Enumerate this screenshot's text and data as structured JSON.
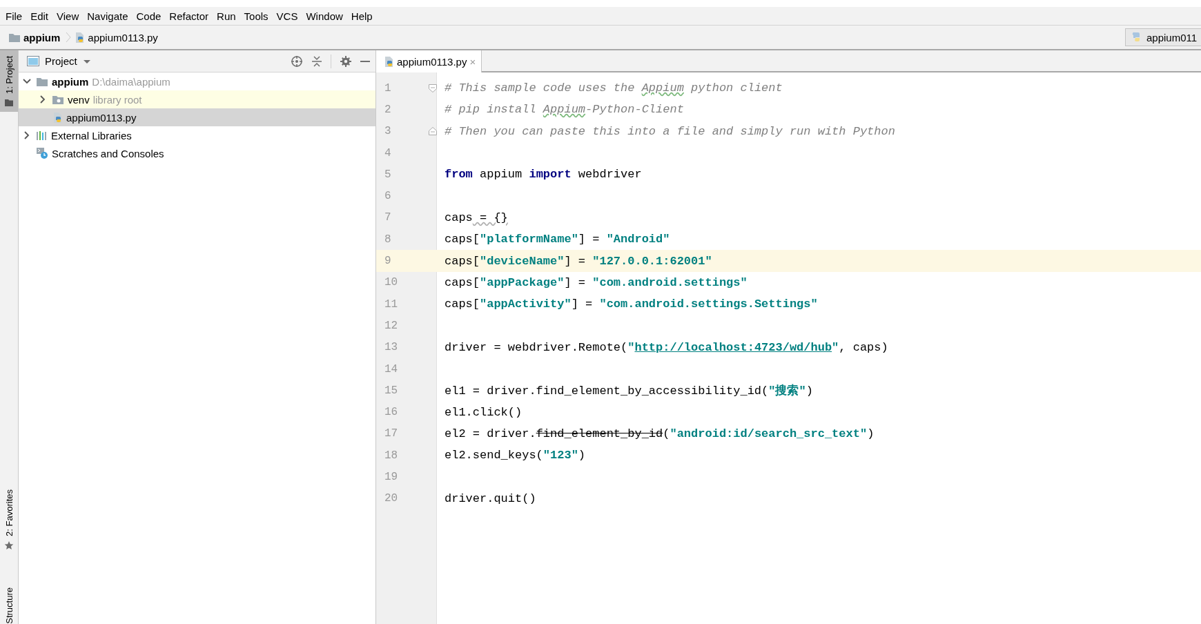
{
  "menu_bar": [
    "File",
    "Edit",
    "View",
    "Navigate",
    "Code",
    "Refactor",
    "Run",
    "Tools",
    "VCS",
    "Window",
    "Help"
  ],
  "breadcrumbs": [
    {
      "label": "appium",
      "kind": "folder"
    },
    {
      "label": "appium0113.py",
      "kind": "python"
    }
  ],
  "run_config": {
    "label": "appium011"
  },
  "tool_stripe": [
    {
      "label": "1: Project",
      "kind": "folder",
      "selected": true
    },
    {
      "label": "2: Favorites",
      "kind": "star",
      "selected": false
    },
    {
      "label": "Structure",
      "kind": "none",
      "selected": false
    }
  ],
  "project_panel": {
    "title": "Project",
    "tree": [
      {
        "label": "appium",
        "hint": "D:\\daima\\appium",
        "kind": "folder",
        "bold": true,
        "expanded": true,
        "selected": false,
        "highlighted": false,
        "children": [
          {
            "label": "venv",
            "hint": "library root",
            "kind": "library-folder",
            "bold": false,
            "expanded": false,
            "selected": false,
            "highlighted": true
          },
          {
            "label": "appium0113.py",
            "kind": "python",
            "bold": false,
            "selected": true,
            "highlighted": false
          }
        ]
      },
      {
        "label": "External Libraries",
        "kind": "libraries",
        "bold": false,
        "expanded": false,
        "selected": false,
        "highlighted": false
      },
      {
        "label": "Scratches and Consoles",
        "kind": "scratches",
        "bold": false,
        "selected": false,
        "highlighted": false
      }
    ]
  },
  "editor": {
    "tabs": [
      {
        "label": "appium0113.py",
        "close": "×",
        "selected": true
      }
    ],
    "lines": [
      {
        "number": "1",
        "current": false,
        "kind": "fold-start",
        "segments": [
          {
            "kind": "comment",
            "text": "# This sample code uses the "
          },
          {
            "kind": "comment-typo",
            "text": "Appium"
          },
          {
            "kind": "comment",
            "text": " python client"
          }
        ]
      },
      {
        "number": "2",
        "current": false,
        "segments": [
          {
            "kind": "comment",
            "text": "# pip install "
          },
          {
            "kind": "comment-typo",
            "text": "Appium"
          },
          {
            "kind": "comment",
            "text": "-Python-Client"
          }
        ]
      },
      {
        "number": "3",
        "current": false,
        "kind": "fold-end",
        "segments": [
          {
            "kind": "comment",
            "text": "# Then you can paste this into a file and simply run with Python"
          }
        ]
      },
      {
        "number": "4",
        "current": false
      },
      {
        "number": "5",
        "current": false,
        "segments": [
          {
            "kind": "keyword",
            "text": "from"
          },
          {
            "kind": "plain",
            "text": " appium "
          },
          {
            "kind": "keyword",
            "text": "import"
          },
          {
            "kind": "plain",
            "text": " webdriver"
          }
        ]
      },
      {
        "number": "6",
        "current": false
      },
      {
        "number": "7",
        "current": false,
        "segments": [
          {
            "kind": "plain",
            "text": "caps"
          },
          {
            "kind": "warning",
            "text": " = {}"
          }
        ]
      },
      {
        "number": "8",
        "current": false,
        "segments": [
          {
            "kind": "plain",
            "text": "caps["
          },
          {
            "kind": "string",
            "text": "\"platformName\""
          },
          {
            "kind": "plain",
            "text": "] = "
          },
          {
            "kind": "string",
            "text": "\"Android\""
          }
        ]
      },
      {
        "number": "9",
        "current": true,
        "segments": [
          {
            "kind": "plain",
            "text": "caps["
          },
          {
            "kind": "string",
            "text": "\"deviceName\""
          },
          {
            "kind": "plain",
            "text": "] = "
          },
          {
            "kind": "string",
            "text": "\"127.0.0.1:62001\""
          }
        ]
      },
      {
        "number": "10",
        "current": false,
        "segments": [
          {
            "kind": "plain",
            "text": "caps["
          },
          {
            "kind": "string",
            "text": "\"appPackage\""
          },
          {
            "kind": "plain",
            "text": "] = "
          },
          {
            "kind": "string",
            "text": "\"com.android.settings\""
          }
        ]
      },
      {
        "number": "11",
        "current": false,
        "segments": [
          {
            "kind": "plain",
            "text": "caps["
          },
          {
            "kind": "string",
            "text": "\"appActivity\""
          },
          {
            "kind": "plain",
            "text": "] = "
          },
          {
            "kind": "string",
            "text": "\"com.android.settings.Settings\""
          }
        ]
      },
      {
        "number": "12",
        "current": false
      },
      {
        "number": "13",
        "current": false,
        "segments": [
          {
            "kind": "plain",
            "text": "driver = webdriver.Remote("
          },
          {
            "kind": "string",
            "text": "\""
          },
          {
            "kind": "link",
            "text": "http://localhost:4723/wd/hub"
          },
          {
            "kind": "string",
            "text": "\""
          },
          {
            "kind": "plain",
            "text": ", caps)"
          }
        ]
      },
      {
        "number": "14",
        "current": false
      },
      {
        "number": "15",
        "current": false,
        "segments": [
          {
            "kind": "plain",
            "text": "el1 = driver.find_element_by_accessibility_id("
          },
          {
            "kind": "string",
            "text": "\"搜索\""
          },
          {
            "kind": "plain",
            "text": ")"
          }
        ]
      },
      {
        "number": "16",
        "current": false,
        "segments": [
          {
            "kind": "plain",
            "text": "el1.click()"
          }
        ]
      },
      {
        "number": "17",
        "current": false,
        "segments": [
          {
            "kind": "plain",
            "text": "el2 = driver."
          },
          {
            "kind": "deprecated",
            "text": "find_element_by_id"
          },
          {
            "kind": "plain",
            "text": "("
          },
          {
            "kind": "string",
            "text": "\"android:id/search_src_text\""
          },
          {
            "kind": "plain",
            "text": ")"
          }
        ]
      },
      {
        "number": "18",
        "current": false,
        "segments": [
          {
            "kind": "plain",
            "text": "el2.send_keys("
          },
          {
            "kind": "string",
            "text": "\"123\""
          },
          {
            "kind": "plain",
            "text": ")"
          }
        ]
      },
      {
        "number": "19",
        "current": false
      },
      {
        "number": "20",
        "current": false,
        "segments": [
          {
            "kind": "plain",
            "text": "driver.quit()"
          }
        ]
      }
    ]
  }
}
